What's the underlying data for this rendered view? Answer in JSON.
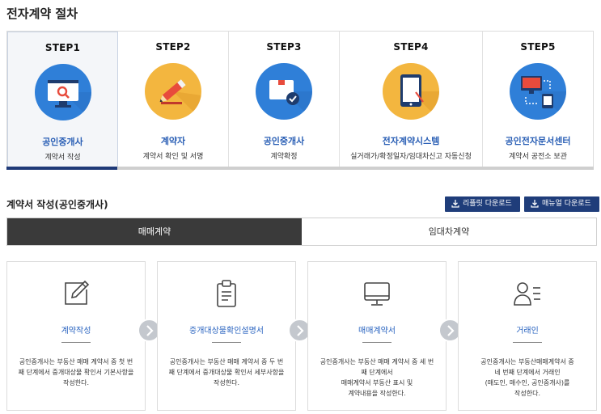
{
  "page": {
    "title": "전자계약 절차"
  },
  "steps": [
    {
      "num": "STEP1",
      "role": "공인중개사",
      "desc": "계약서 작성",
      "icon": "monitor-search-icon",
      "color": "#2f7fd8"
    },
    {
      "num": "STEP2",
      "role": "계약자",
      "desc": "계약서 확인 및 서명",
      "icon": "pencil-sign-icon",
      "color": "#f3b63f"
    },
    {
      "num": "STEP3",
      "role": "공인중개사",
      "desc": "계약확정",
      "icon": "document-check-icon",
      "color": "#2f7fd8"
    },
    {
      "num": "STEP4",
      "role": "전자계약시스템",
      "desc": "실거래가/확정일자/임대차신고 자동신청",
      "icon": "tablet-icon",
      "color": "#f3b63f"
    },
    {
      "num": "STEP5",
      "role": "공인전자문서센터",
      "desc": "계약서 공전소 보관",
      "icon": "devices-sync-icon",
      "color": "#2f7fd8"
    }
  ],
  "section": {
    "title": "계약서 작성(공인중개사)",
    "leaflet_button": "리플릿 다운로드",
    "manual_button": "매뉴얼 다운로드"
  },
  "tabs": [
    {
      "label": "매매계약",
      "active": true
    },
    {
      "label": "임대차계약",
      "active": false
    }
  ],
  "cards": [
    {
      "title": "계약작성",
      "icon": "edit-icon",
      "desc_lines": [
        "공인중개사는 부동산 매매 계약서 중 첫 번",
        "째 단계에서 중개대상물 확인서 기본사항을",
        "작성한다."
      ]
    },
    {
      "title": "중개대상물확인설명서",
      "icon": "clipboard-icon",
      "desc_lines": [
        "공인중개사는 부동산 매매 계약서 중 두 번",
        "째 단계에서 중개대상물 확인서 세부사항을",
        "작성한다."
      ]
    },
    {
      "title": "매매계약서",
      "icon": "desktop-icon",
      "desc_lines": [
        "공인중개사는 부동산 매매 계약서 중 세 번",
        "째 단계에서",
        "매매계약서 부동산 표시 및",
        "계약내용을 작성한다."
      ]
    },
    {
      "title": "거래인",
      "icon": "person-list-icon",
      "desc_lines": [
        "공인중개사는 부동산매매계약서 중",
        "네 번째 단계에서 거래인",
        "(매도인, 매수인, 공인중개사)를",
        "작성한다."
      ]
    }
  ],
  "colors": {
    "accent_blue": "#2a64c0",
    "navy": "#1f3d7a",
    "tab_dark": "#3a3a3a"
  }
}
